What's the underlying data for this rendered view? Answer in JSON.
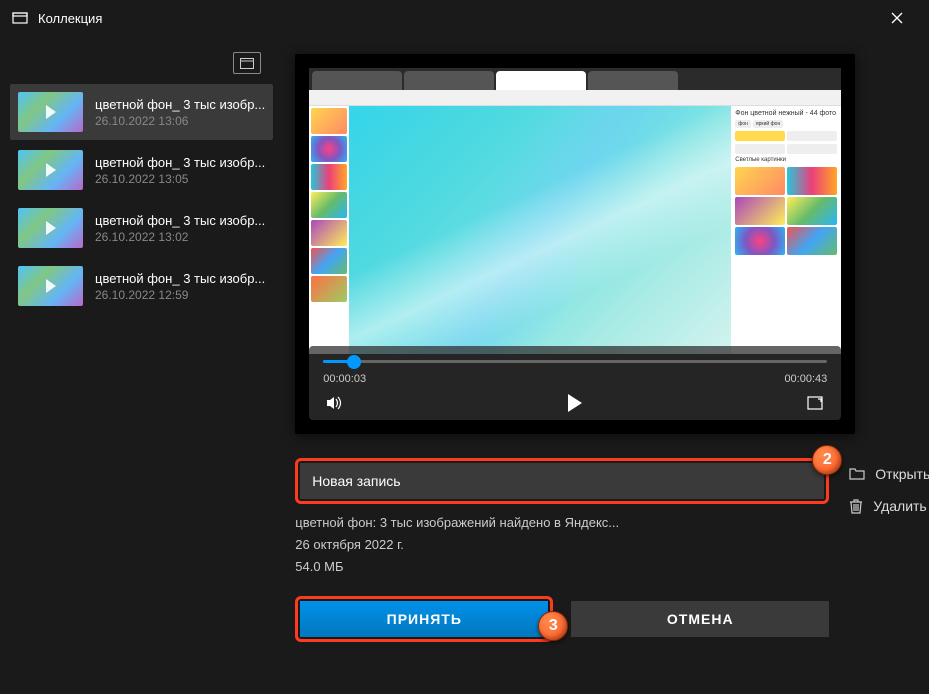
{
  "titlebar": {
    "title": "Коллекция"
  },
  "sidebar": {
    "items": [
      {
        "title": "цветной фон_ 3 тыс изобр...",
        "date": "26.10.2022 13:06",
        "selected": true
      },
      {
        "title": "цветной фон_ 3 тыс изобр...",
        "date": "26.10.2022 13:05",
        "selected": false
      },
      {
        "title": "цветной фон_ 3 тыс изобр...",
        "date": "26.10.2022 13:02",
        "selected": false
      },
      {
        "title": "цветной фон_ 3 тыс изобр...",
        "date": "26.10.2022 12:59",
        "selected": false
      }
    ]
  },
  "player": {
    "current_time": "00:00:03",
    "total_time": "00:00:43"
  },
  "form": {
    "name_value": "Новая запись",
    "full_title": "цветной фон: 3 тыс изображений найдено в Яндекс...",
    "date": "26 октября 2022 г.",
    "size": "54.0 МБ",
    "accept_label": "ПРИНЯТЬ",
    "cancel_label": "ОТМЕНА"
  },
  "actions": {
    "open_folder": "Открыть папку с фа...",
    "delete": "Удалить"
  },
  "annotations": {
    "badge2": "2",
    "badge3": "3"
  }
}
